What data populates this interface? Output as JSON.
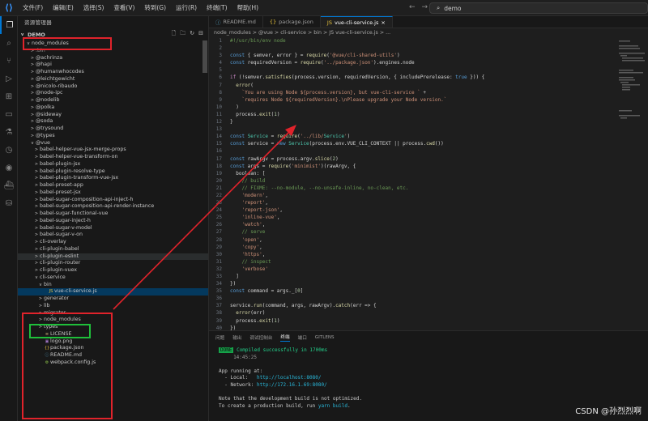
{
  "menu": [
    "文件(F)",
    "编辑(E)",
    "选择(S)",
    "查看(V)",
    "转到(G)",
    "运行(R)",
    "终端(T)",
    "帮助(H)"
  ],
  "search": {
    "text": "demo"
  },
  "explorer": {
    "title": "资源管理器",
    "root": "DEMO",
    "tree": [
      {
        "label": "node_modules",
        "indent": 1,
        "chev": "v",
        "kind": "folder"
      },
      {
        "label": ".bin",
        "indent": 2,
        "chev": ">",
        "kind": "folder",
        "dim": true
      },
      {
        "label": "@achrinza",
        "indent": 2,
        "chev": ">",
        "kind": "folder"
      },
      {
        "label": "@hapi",
        "indent": 2,
        "chev": ">",
        "kind": "folder"
      },
      {
        "label": "@humanwhocodes",
        "indent": 2,
        "chev": ">",
        "kind": "folder"
      },
      {
        "label": "@leichtgewicht",
        "indent": 2,
        "chev": ">",
        "kind": "folder"
      },
      {
        "label": "@nicolo-ribaudo",
        "indent": 2,
        "chev": ">",
        "kind": "folder"
      },
      {
        "label": "@node-ipc",
        "indent": 2,
        "chev": ">",
        "kind": "folder"
      },
      {
        "label": "@nodelib",
        "indent": 2,
        "chev": ">",
        "kind": "folder"
      },
      {
        "label": "@polka",
        "indent": 2,
        "chev": ">",
        "kind": "folder"
      },
      {
        "label": "@sideway",
        "indent": 2,
        "chev": ">",
        "kind": "folder"
      },
      {
        "label": "@soda",
        "indent": 2,
        "chev": ">",
        "kind": "folder"
      },
      {
        "label": "@trysound",
        "indent": 2,
        "chev": ">",
        "kind": "folder"
      },
      {
        "label": "@types",
        "indent": 2,
        "chev": ">",
        "kind": "folder"
      },
      {
        "label": "@vue",
        "indent": 2,
        "chev": "v",
        "kind": "folder"
      },
      {
        "label": "babel-helper-vue-jsx-merge-props",
        "indent": 3,
        "chev": ">",
        "kind": "folder"
      },
      {
        "label": "babel-helper-vue-transform-on",
        "indent": 3,
        "chev": ">",
        "kind": "folder"
      },
      {
        "label": "babel-plugin-jsx",
        "indent": 3,
        "chev": ">",
        "kind": "folder"
      },
      {
        "label": "babel-plugin-resolve-type",
        "indent": 3,
        "chev": ">",
        "kind": "folder"
      },
      {
        "label": "babel-plugin-transform-vue-jsx",
        "indent": 3,
        "chev": ">",
        "kind": "folder"
      },
      {
        "label": "babel-preset-app",
        "indent": 3,
        "chev": ">",
        "kind": "folder"
      },
      {
        "label": "babel-preset-jsx",
        "indent": 3,
        "chev": ">",
        "kind": "folder"
      },
      {
        "label": "babel-sugar-composition-api-inject-h",
        "indent": 3,
        "chev": ">",
        "kind": "folder"
      },
      {
        "label": "babel-sugar-composition-api-render-instance",
        "indent": 3,
        "chev": ">",
        "kind": "folder"
      },
      {
        "label": "babel-sugar-functional-vue",
        "indent": 3,
        "chev": ">",
        "kind": "folder"
      },
      {
        "label": "babel-sugar-inject-h",
        "indent": 3,
        "chev": ">",
        "kind": "folder"
      },
      {
        "label": "babel-sugar-v-model",
        "indent": 3,
        "chev": ">",
        "kind": "folder"
      },
      {
        "label": "babel-sugar-v-on",
        "indent": 3,
        "chev": ">",
        "kind": "folder"
      },
      {
        "label": "cli-overlay",
        "indent": 3,
        "chev": ">",
        "kind": "folder"
      },
      {
        "label": "cli-plugin-babel",
        "indent": 3,
        "chev": ">",
        "kind": "folder"
      },
      {
        "label": "cli-plugin-eslint",
        "indent": 3,
        "chev": ">",
        "kind": "folder",
        "hl": true
      },
      {
        "label": "cli-plugin-router",
        "indent": 3,
        "chev": ">",
        "kind": "folder"
      },
      {
        "label": "cli-plugin-vuex",
        "indent": 3,
        "chev": ">",
        "kind": "folder"
      },
      {
        "label": "cli-service",
        "indent": 3,
        "chev": "v",
        "kind": "folder"
      },
      {
        "label": "bin",
        "indent": 4,
        "chev": "v",
        "kind": "folder"
      },
      {
        "label": "vue-cli-service.js",
        "indent": 5,
        "chev": "",
        "kind": "js",
        "sel": true
      },
      {
        "label": "generator",
        "indent": 4,
        "chev": ">",
        "kind": "folder"
      },
      {
        "label": "lib",
        "indent": 4,
        "chev": ">",
        "kind": "folder"
      },
      {
        "label": "migrator",
        "indent": 4,
        "chev": ">",
        "kind": "folder"
      },
      {
        "label": "node_modules",
        "indent": 4,
        "chev": ">",
        "kind": "folder"
      },
      {
        "label": "types",
        "indent": 4,
        "chev": ">",
        "kind": "folder"
      },
      {
        "label": "LICENSE",
        "indent": 4,
        "chev": "",
        "kind": "license"
      },
      {
        "label": "logo.png",
        "indent": 4,
        "chev": "",
        "kind": "img"
      },
      {
        "label": "package.json",
        "indent": 4,
        "chev": "",
        "kind": "json"
      },
      {
        "label": "README.md",
        "indent": 4,
        "chev": "",
        "kind": "md"
      },
      {
        "label": "webpack.config.js",
        "indent": 4,
        "chev": "",
        "kind": "cfg"
      }
    ]
  },
  "tabs": [
    {
      "label": "README.md",
      "icon": "ⓘ",
      "active": false
    },
    {
      "label": "package.json",
      "icon": "{}",
      "active": false
    },
    {
      "label": "vue-cli-service.js",
      "icon": "JS",
      "active": true
    }
  ],
  "breadcrumb": "node_modules > @vue > cli-service > bin > JS vue-cli-service.js > ...",
  "code": [
    "#!/usr/bin/env node",
    "",
    "const { semver, error } = require('@vue/cli-shared-utils')",
    "const requiredVersion = require('../package.json').engines.node",
    "",
    "if (!semver.satisfies(process.version, requiredVersion, { includePrerelease: true })) {",
    "  error(",
    "    `You are using Node ${process.version}, but vue-cli-service ` +",
    "    `requires Node ${requiredVersion}.\\nPlease upgrade your Node version.`",
    "  )",
    "  process.exit(1)",
    "}",
    "",
    "const Service = require('../lib/Service')",
    "const service = new Service(process.env.VUE_CLI_CONTEXT || process.cwd())",
    "",
    "const rawArgv = process.argv.slice(2)",
    "const args = require('minimist')(rawArgv, {",
    "  boolean: [",
    "    // build",
    "    // FIXME: --no-module, --no-unsafe-inline, no-clean, etc.",
    "    'modern',",
    "    'report',",
    "    'report-json',",
    "    'inline-vue',",
    "    'watch',",
    "    // serve",
    "    'open',",
    "    'copy',",
    "    'https',",
    "    // inspect",
    "    'verbose'",
    "  ]",
    "})",
    "const command = args._[0]",
    "",
    "service.run(command, args, rawArgv).catch(err => {",
    "  error(err)",
    "  process.exit(1)",
    "})",
    ""
  ],
  "panel": {
    "tabs": [
      "问题",
      "输出",
      "调试控制台",
      "终端",
      "端口",
      "GITLENS"
    ],
    "active_tab": "终端",
    "done": "DONE",
    "compiled": "Compiled successfully in 1700ms",
    "time": "14:45:25",
    "running": "App running at:",
    "local_label": "- Local:   ",
    "local_url": "http://localhost:8080/",
    "network_label": "- Network: ",
    "network_url": "http://172.16.1.69:8080/",
    "note1": "Note that the development build is not optimized.",
    "note2_prefix": "To create a production build, run ",
    "note2_cmd": "yarn build",
    "note2_suffix": "."
  },
  "watermark": "CSDN @孙烈烈啊"
}
